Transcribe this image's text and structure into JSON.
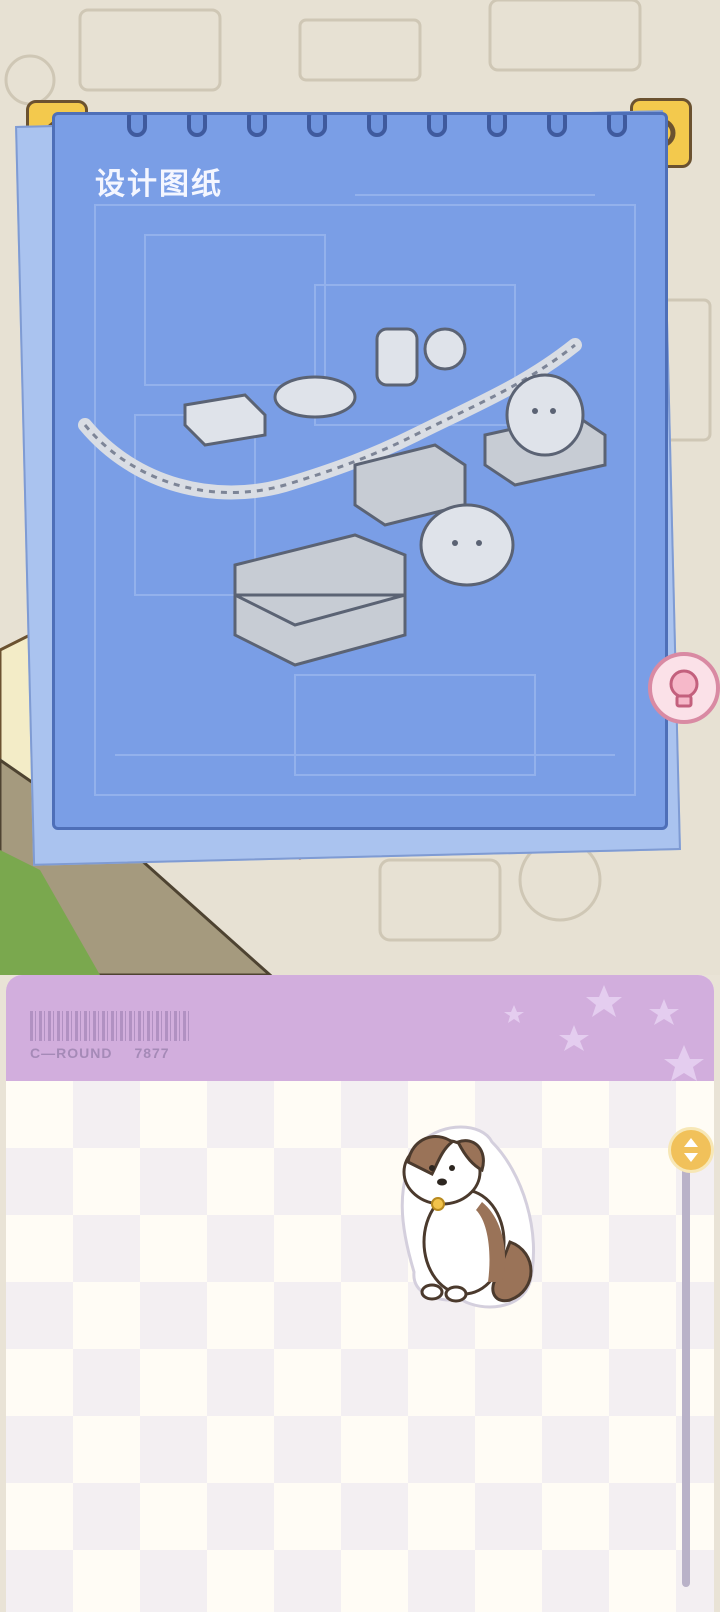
{
  "blueprint": {
    "title": "设计图纸"
  },
  "tray": {
    "barcode_label": "C—ROUND",
    "barcode_number": "7877"
  },
  "icons": {
    "back": "back-arrow-icon",
    "settings": "gear-icon",
    "hint": "lightbulb-icon",
    "scroll": "scroll-arrows-icon"
  },
  "colors": {
    "blueprint": "#7a9ee6",
    "tray_header": "#d2aedd",
    "button_yellow": "#f3c94d"
  }
}
